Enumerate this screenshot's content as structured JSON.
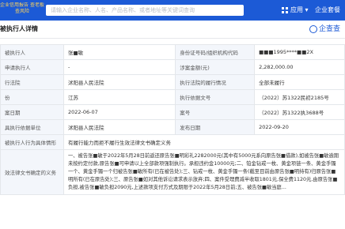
{
  "topbar": {
    "brand": "企业信用报告 查老板 查风险",
    "search_placeholder": "请输入企业名称、人名、产品名称、或者地址等关键词查询",
    "apps_label": "应用",
    "apps_caret": "▾",
    "enterprise_label": "企业套餐"
  },
  "dialog": {
    "title": "被执行人详情",
    "logo_text": "企查查"
  },
  "rows": [
    {
      "l1": "被执行人",
      "v1": "张■敏",
      "l2": "身份证号码/组织机构代码",
      "v2": "■■■1995****■■2X"
    },
    {
      "l1": "申请执行人",
      "v1": "-",
      "l2": "涉案金额(元)",
      "v2": "2,282,000.00"
    },
    {
      "l1": "行法院",
      "v1": "沭阳县人民法院",
      "l2": "执行法院的履行情况",
      "v2": "全部未履行"
    },
    {
      "l1": "份",
      "v1": "江苏",
      "l2": "执行依据文号",
      "v2": "（2022）苏1322民初2185号"
    },
    {
      "l1": "案日期",
      "v1": "2022-06-07",
      "l2": "案号",
      "v2": "（2022）苏1322执3688号"
    },
    {
      "l1": "具执行依据单位",
      "v1": "沭阳县人民法院",
      "l2": "发布日期",
      "v2": "2022-09-20"
    }
  ],
  "situation": {
    "label": "被执行人行为具体情形",
    "value": "有履行能力而拒不履行生效法律文书确定义务"
  },
  "obligation": {
    "label": "效法律文书确定的义务",
    "text": "一、被告张■敏于2022年5月28日前返还原告张■明彩礼2282000元(其中有5000元系向原告张■借款),如被告张■敏逾期未按约定付款,原告张■可申请以上全部款项强制执行。承担违约金10000元;二、铂金钻戒一枚、黄金项链一条、黄金手镯一个、黄金手镯一个归被告张■敏所有(已在被告处);三、钻戒一枚、黄金手镯一条(截至目前由原告张■明持有)归原告张■明所有(已在原告处);三、原告张■如对其他诉讼请求表示放弃;四、案件受理费减半收取1801元,保全费1120元,由原告张■负担,被告张■敏负担2090元,上述款项支付方式及期限于2022年5月28日前;五、被告张■敏当庭..."
  }
}
